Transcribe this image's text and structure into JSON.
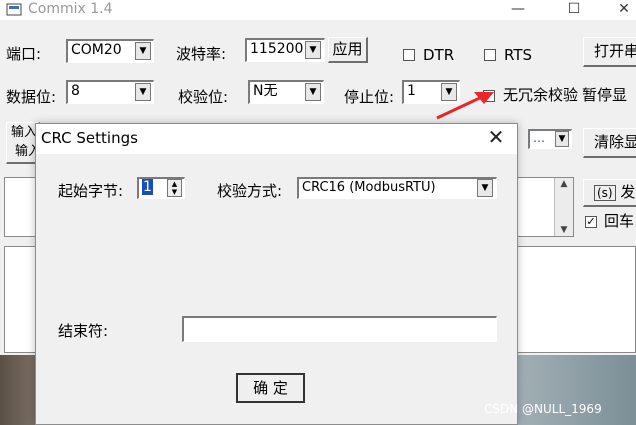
{
  "app": {
    "title": "Commix 1.4",
    "minimize": "—",
    "maximize": "☐",
    "close": "✕"
  },
  "toolbar": {
    "port_label": "端口:",
    "port_value": "COM20",
    "baud_label": "波特率:",
    "baud_value": "115200",
    "apply_label": "应用",
    "dtr_label": "DTR",
    "rts_label": "RTS",
    "open_label": "打开串",
    "databits_label": "数据位:",
    "databits_value": "8",
    "parity_label": "校验位:",
    "parity_value": "N无",
    "stopbits_label": "停止位:",
    "stopbits_value": "1",
    "no_redundancy_label": "无冗余校验",
    "pause_label": "暂停显",
    "input_tab_1": "输入",
    "input_tab_2": "输入",
    "more_label": "…",
    "clear_label": "清除显",
    "send_label": "发",
    "send_icon": "(s)",
    "enter_label": "回车"
  },
  "dialog": {
    "title": "CRC Settings",
    "close": "✕",
    "start_byte_label": "起始字节:",
    "start_byte_value": "1",
    "check_mode_label": "校验方式:",
    "check_mode_value": "CRC16 (ModbusRTU)",
    "terminator_label": "结束符:",
    "terminator_value": "",
    "ok_label": "确 定"
  },
  "watermark": "CSDN @NULL_1969",
  "colors": {
    "arrow": "#e8262b",
    "title_gray": "#999999"
  }
}
